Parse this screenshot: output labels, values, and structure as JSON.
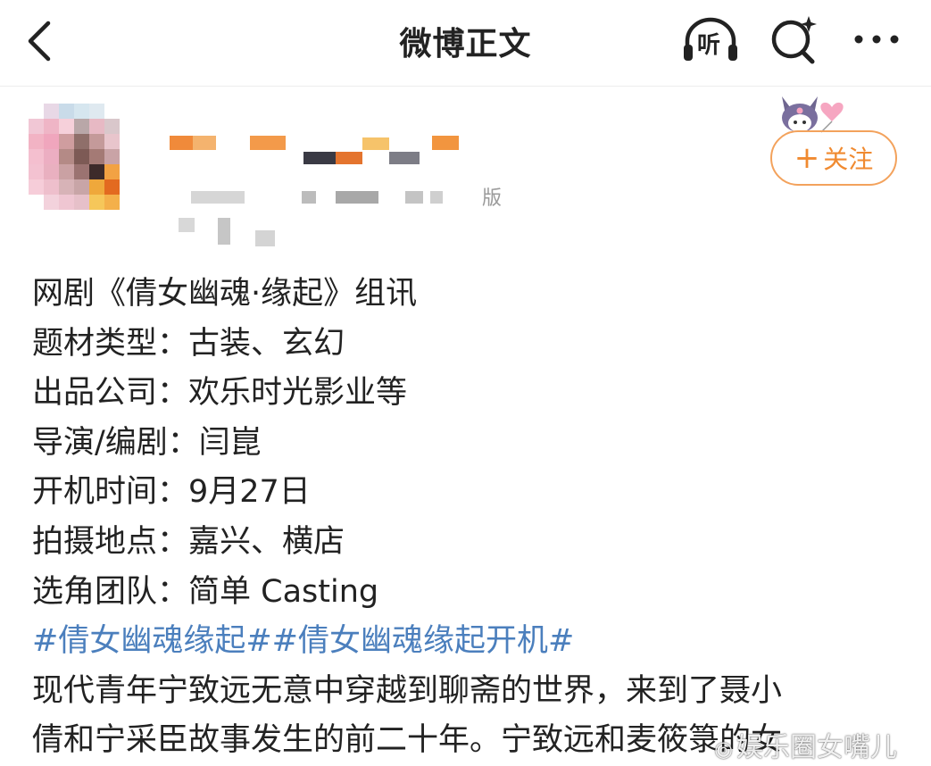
{
  "nav": {
    "title": "微博正文",
    "listen_label": "听",
    "icons": {
      "back": "chevron-left-icon",
      "listen": "headphones-icon",
      "search": "search-sparkle-icon",
      "more": "more-dots-icon"
    }
  },
  "author": {
    "meta_suffix": "版",
    "follow_label": "关注",
    "follow_plus": "+"
  },
  "post": {
    "lines": [
      "网剧《倩女幽魂·缘起》组讯",
      "题材类型：古装、玄幻",
      "出品公司：欢乐时光影业等",
      "导演/编剧：闫崑",
      "开机时间：9月27日",
      "拍摄地点：嘉兴、横店",
      "选角团队：简单 Casting"
    ],
    "topics": [
      "#倩女幽魂缘起#",
      "#倩女幽魂缘起开机#"
    ],
    "body_lines": [
      "现代青年宁致远无意中穿越到聊斋的世界，来到了聂小",
      "倩和宁采臣故事发生的前二十年。宁致远和麦筱箓的女"
    ]
  },
  "watermark": {
    "text": "娱乐圈女嘴儿"
  },
  "colors": {
    "accent": "#f08a30",
    "topic": "#4b7fbd",
    "text": "#222222"
  }
}
